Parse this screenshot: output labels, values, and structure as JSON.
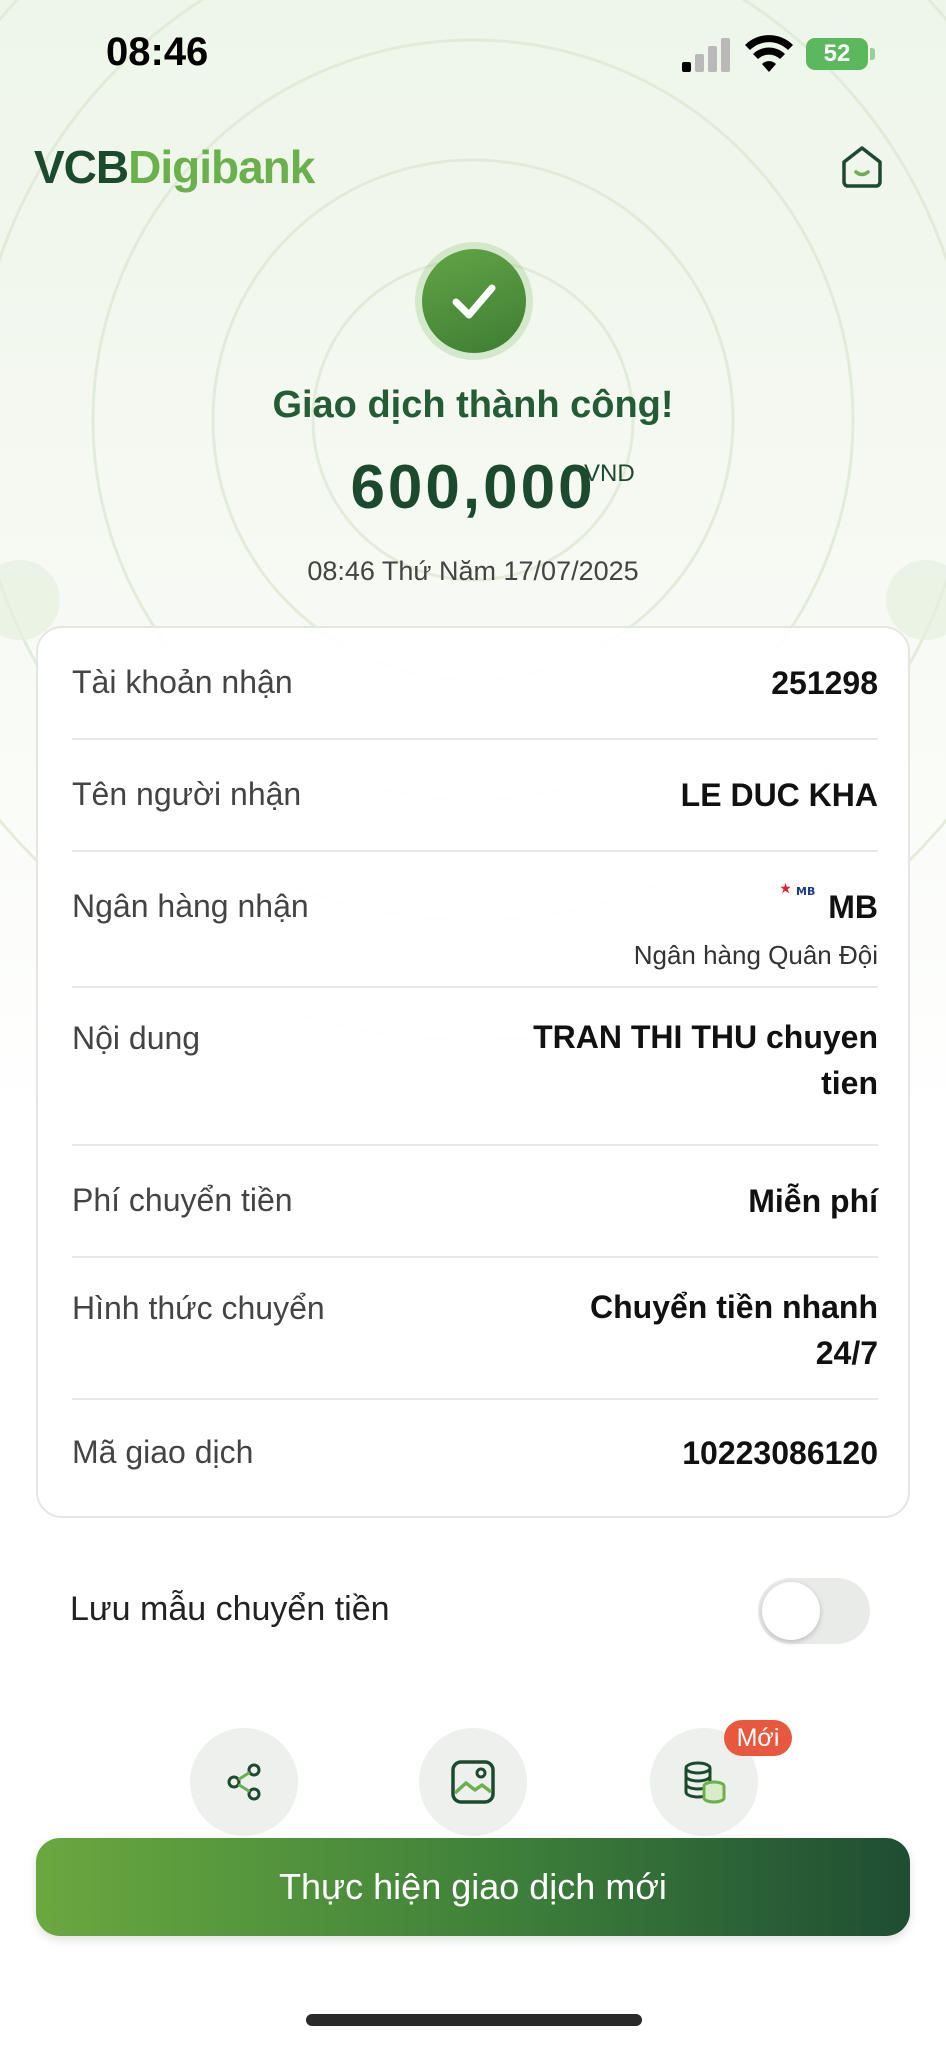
{
  "status_bar": {
    "time": "08:46",
    "battery": "52"
  },
  "header": {
    "logo_part1": "VCB",
    "logo_part2": "Digibank"
  },
  "result": {
    "title": "Giao dịch thành công!",
    "amount": "600,000",
    "currency": "VND",
    "datetime": "08:46 Thứ Năm 17/07/2025"
  },
  "details": [
    {
      "label": "Tài khoản nhận",
      "value": "251298"
    },
    {
      "label": "Tên người nhận",
      "value": "LE DUC KHA"
    },
    {
      "label": "Ngân hàng nhận",
      "value": "MB",
      "sub": "Ngân hàng Quân Đội",
      "logo_text": "MB"
    },
    {
      "label": "Nội dung",
      "value_line1": "TRAN THI THU chuyen",
      "value_line2": "tien"
    },
    {
      "label": "Phí chuyển tiền",
      "value": "Miễn phí"
    },
    {
      "label": "Hình thức chuyển",
      "value_line1": "Chuyển tiền nhanh",
      "value_line2": "24/7"
    },
    {
      "label": "Mã giao dịch",
      "value": "10223086120"
    }
  ],
  "save_template": {
    "label": "Lưu mẫu chuyển tiền",
    "enabled": false
  },
  "actions": [
    {
      "icon": "share-icon"
    },
    {
      "icon": "image-icon"
    },
    {
      "icon": "coins-icon",
      "badge": "Mới"
    }
  ],
  "primary_button": "Thực hiện giao dịch mới",
  "colors": {
    "brand_dark": "#1c4a2e",
    "brand_light": "#6ab04c",
    "badge": "#e8583f"
  }
}
